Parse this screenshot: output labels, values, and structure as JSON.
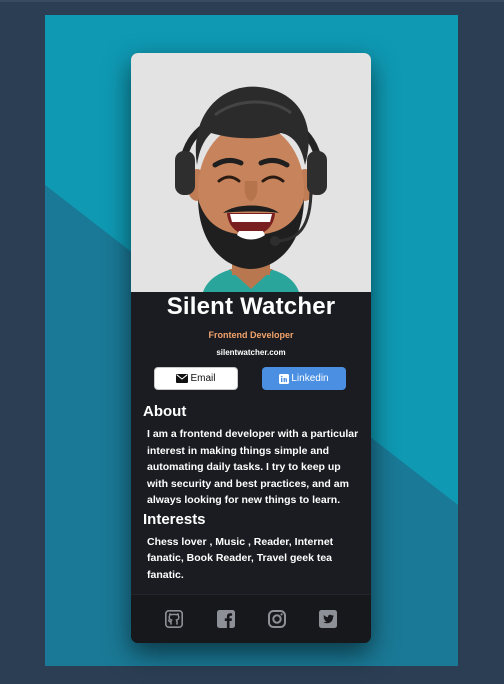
{
  "profile": {
    "name": "Silent Watcher",
    "role": "Frontend Developer",
    "website": "silentwatcher.com"
  },
  "buttons": {
    "email": "Email",
    "linkedin": "Linkedin"
  },
  "about": {
    "heading": "About",
    "text": "I am a frontend developer with a particular interest in making things simple and automating daily tasks. I try to keep up with security and best practices, and am always looking for new things to learn."
  },
  "interests": {
    "heading": "Interests",
    "text": "Chess lover , Music , Reader, Internet fanatic, Book Reader, Travel geek tea fanatic."
  },
  "social": [
    "github-icon",
    "facebook-icon",
    "instagram-icon",
    "twitter-icon"
  ],
  "colors": {
    "page_background": "#2b3e53",
    "canvas_teal": "#0f99b3",
    "canvas_dark_teal": "#1a7996",
    "card_background": "#1b1c21",
    "role_accent": "#f2a36b",
    "linkedin_blue": "#4a8fe2"
  }
}
